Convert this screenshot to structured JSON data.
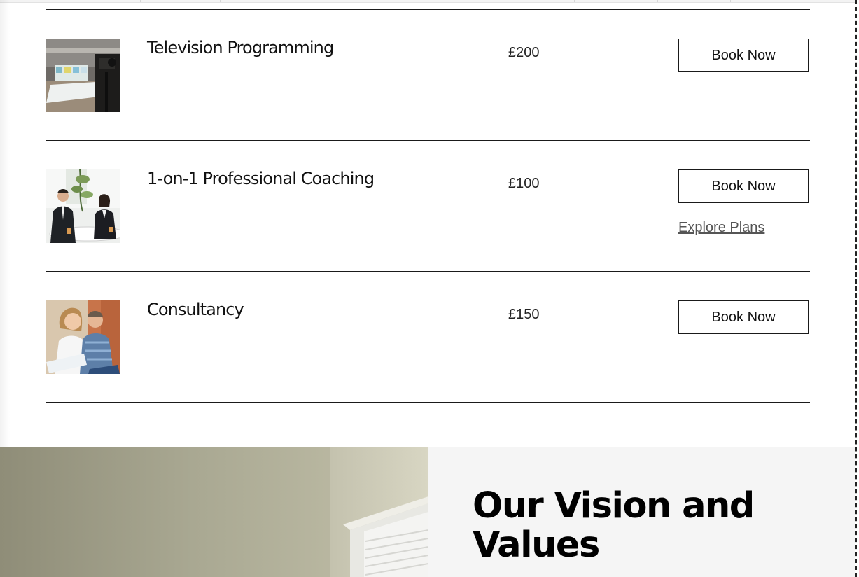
{
  "services": [
    {
      "name": "Television Programming",
      "price": "£200",
      "book_label": "Book Now",
      "image": "tv-studio-image"
    },
    {
      "name": "1-on-1 Professional Coaching",
      "price": "£100",
      "book_label": "Book Now",
      "secondary_link": "Explore Plans",
      "image": "business-meeting-image"
    },
    {
      "name": "Consultancy",
      "price": "£150",
      "book_label": "Book Now",
      "image": "couple-consultation-image"
    }
  ],
  "vision": {
    "title": "Our Vision and Values",
    "image": "window-blinds-image"
  },
  "colors": {
    "text": "#111111",
    "divider": "#1a1a1a",
    "panel_bg": "#f5f5f5",
    "link": "#555555"
  }
}
